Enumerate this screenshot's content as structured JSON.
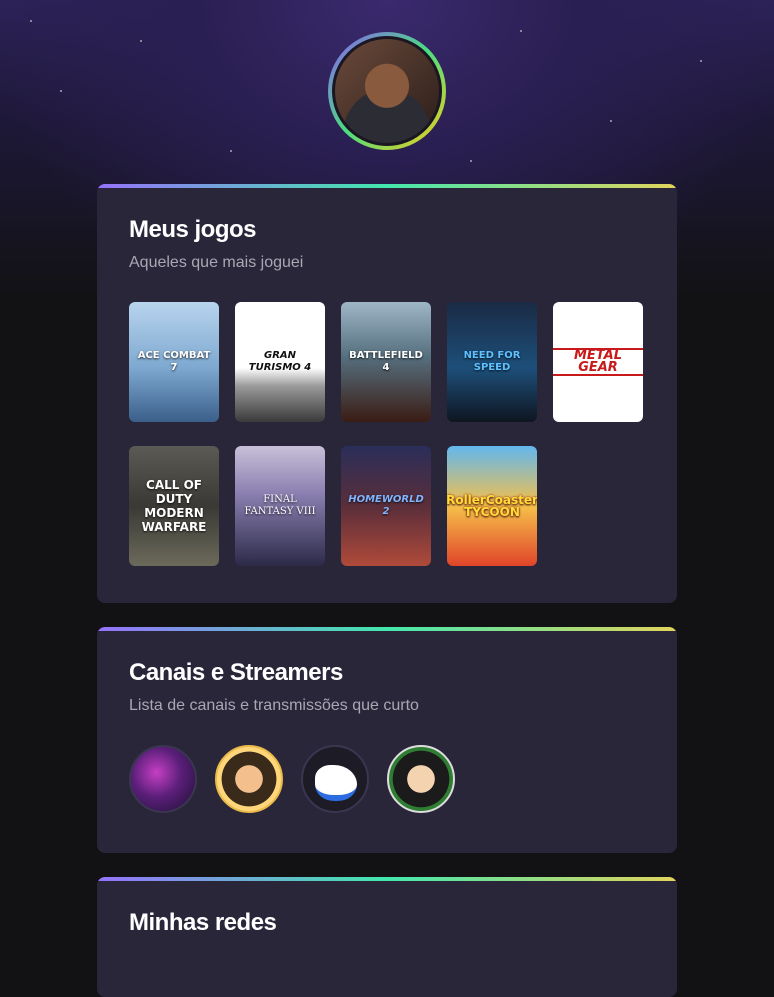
{
  "profile": {
    "avatar_alt": "Avatar"
  },
  "games_section": {
    "title": "Meus jogos",
    "subtitle": "Aqueles que mais joguei",
    "games": [
      {
        "name": "ACE COMBAT 7",
        "icon": "game-cover-ace-combat-7"
      },
      {
        "name": "GRAN TURISMO 4",
        "icon": "game-cover-gran-turismo-4"
      },
      {
        "name": "BATTLEFIELD 4",
        "icon": "game-cover-battlefield-4"
      },
      {
        "name": "NEED FOR SPEED",
        "icon": "game-cover-need-for-speed"
      },
      {
        "name": "METAL GEAR",
        "icon": "game-cover-metal-gear"
      },
      {
        "name": "CALL OF DUTY MODERN WARFARE",
        "icon": "game-cover-call-of-duty-modern-warfare"
      },
      {
        "name": "FINAL FANTASY VIII",
        "icon": "game-cover-final-fantasy-viii"
      },
      {
        "name": "HOMEWORLD 2",
        "icon": "game-cover-homeworld-2"
      },
      {
        "name": "RollerCoaster TYCOON",
        "icon": "game-cover-rollercoaster-tycoon"
      }
    ]
  },
  "channels_section": {
    "title": "Canais e Streamers",
    "subtitle": "Lista de canais e transmissões que curto",
    "channels": [
      {
        "icon": "channel-avatar-1"
      },
      {
        "icon": "channel-avatar-2"
      },
      {
        "icon": "channel-avatar-3"
      },
      {
        "icon": "channel-avatar-4"
      }
    ]
  },
  "networks_section": {
    "title": "Minhas redes"
  },
  "colors": {
    "background": "#121214",
    "card": "#29263a",
    "gradient": [
      "#9572fc",
      "#43e7ad",
      "#e2d45c"
    ],
    "text": "#ffffff",
    "muted": "#a8a8b3"
  }
}
